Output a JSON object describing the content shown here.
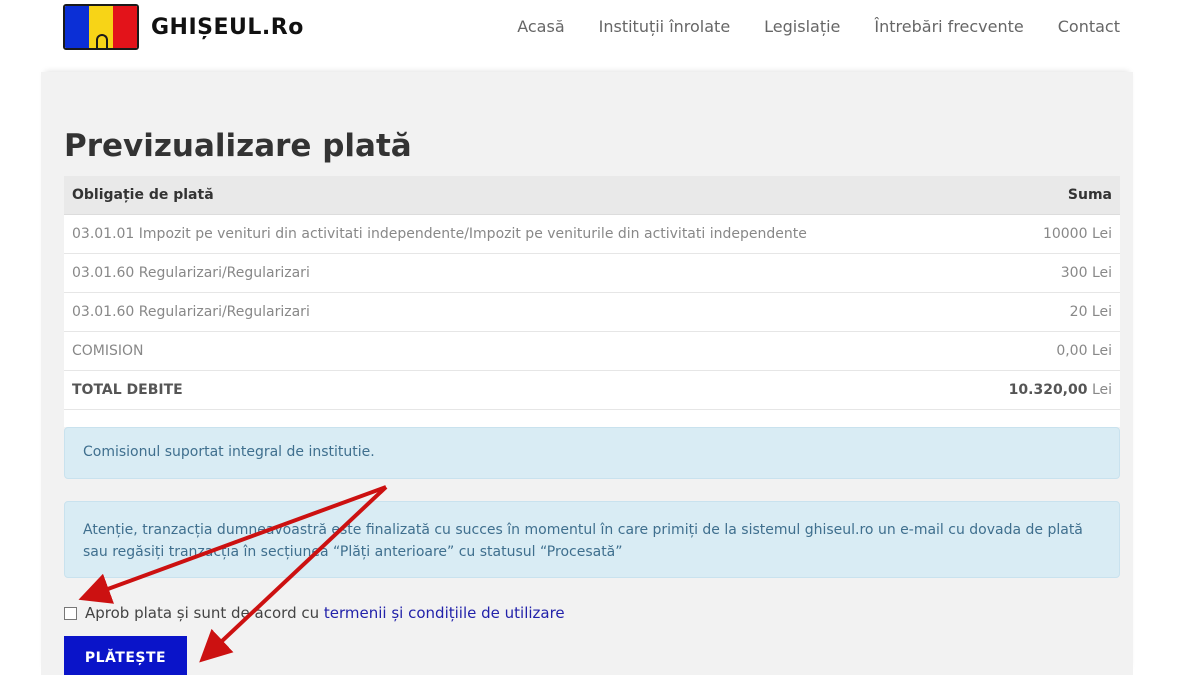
{
  "logo": {
    "text": "GHIȘEUL.Ro"
  },
  "nav": [
    "Acasă",
    "Instituții înrolate",
    "Legislație",
    "Întrebări frecvente",
    "Contact"
  ],
  "page_title": "Previzualizare plată",
  "table": {
    "headers": {
      "obligation": "Obligație de plată",
      "amount": "Suma"
    },
    "rows": [
      {
        "obligation": "03.01.01 Impozit pe venituri din activitati independente/Impozit pe veniturile din activitati independente",
        "amount": "10000 Lei"
      },
      {
        "obligation": "03.01.60 Regularizari/Regularizari",
        "amount": "300 Lei"
      },
      {
        "obligation": "03.01.60 Regularizari/Regularizari",
        "amount": "20 Lei"
      },
      {
        "obligation": "COMISION",
        "amount": "0,00 Lei"
      }
    ],
    "total": {
      "label": "TOTAL DEBITE",
      "amount_value": "10.320,00",
      "amount_unit": "Lei"
    }
  },
  "alerts": {
    "fee_info": "Comisionul suportat integral de institutie.",
    "notice": "Atenție, tranzacția dumneavoastră este finalizată cu succes în momentul în care primiți de la sistemul ghiseul.ro un e-mail cu dovada de plată sau regăsiți tranzacția în secțiunea “Plăți anterioare” cu statusul “Procesată”"
  },
  "agree": {
    "text": "Aprob plata și sunt de acord cu",
    "link": "termenii și condițiile de utilizare"
  },
  "pay_button": "PLĂTEȘTE",
  "colors": {
    "button": "#0a14c9",
    "arrow": "#cc1111",
    "alert_bg": "#d9ecf4"
  }
}
